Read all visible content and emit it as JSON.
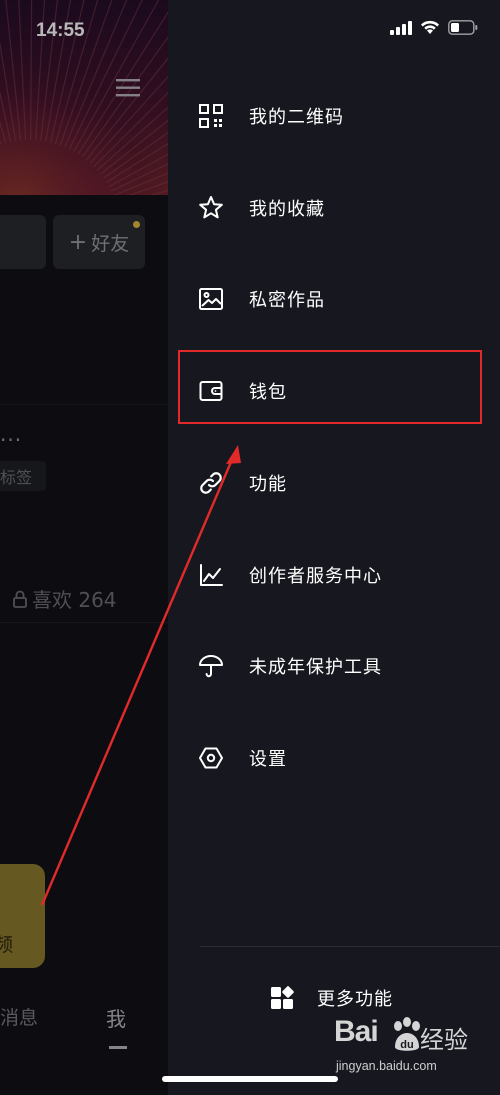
{
  "status_bar": {
    "time": "14:55"
  },
  "profile_page": {
    "add_friend_label": "好友",
    "ellipsis": "...",
    "tag_label": "标签",
    "likes_label": "喜欢 264",
    "fab_label": "频",
    "tab_messages": "消息",
    "tab_me": "我"
  },
  "drawer": {
    "items": [
      {
        "label": "我的二维码",
        "icon": "qr-code-icon"
      },
      {
        "label": "我的收藏",
        "icon": "star-icon"
      },
      {
        "label": "私密作品",
        "icon": "private-image-icon"
      },
      {
        "label": "钱包",
        "icon": "wallet-icon"
      },
      {
        "label": "功能",
        "icon": "link-icon"
      },
      {
        "label": "创作者服务中心",
        "icon": "chart-icon"
      },
      {
        "label": "未成年保护工具",
        "icon": "umbrella-icon"
      },
      {
        "label": "设置",
        "icon": "settings-hexagon-icon"
      }
    ],
    "more_features_label": "更多功能"
  },
  "annotation": {
    "highlight_color": "#e22a2a",
    "highlighted_item": "钱包"
  },
  "watermark": {
    "logo": "Bai",
    "logo_suffix": "du",
    "brand_cn": "经验",
    "url": "jingyan.baidu.com"
  }
}
